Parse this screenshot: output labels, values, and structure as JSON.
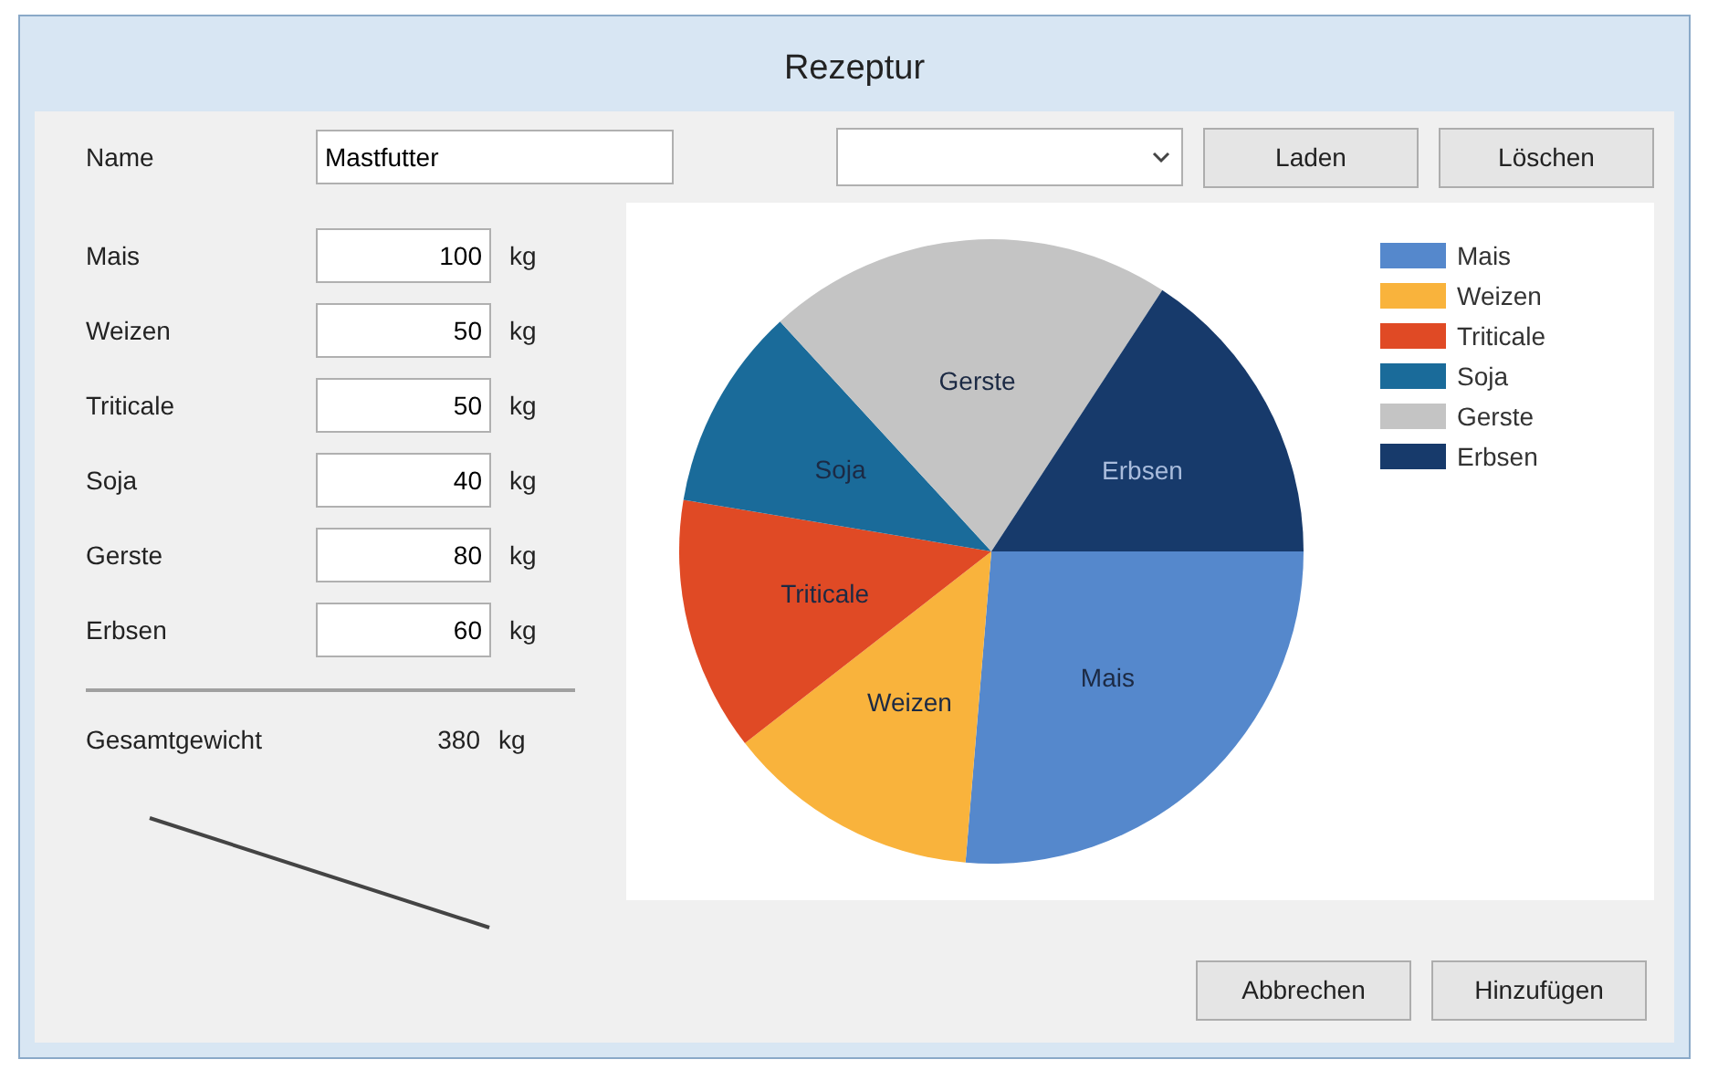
{
  "window": {
    "title": "Rezeptur"
  },
  "name_field": {
    "label": "Name",
    "value": "Mastfutter"
  },
  "buttons_top": [
    "Laden",
    "Löschen"
  ],
  "ingredients": [
    {
      "label": "Mais",
      "value": "100",
      "unit": "kg"
    },
    {
      "label": "Weizen",
      "value": "50",
      "unit": "kg"
    },
    {
      "label": "Triticale",
      "value": "50",
      "unit": "kg"
    },
    {
      "label": "Soja",
      "value": "40",
      "unit": "kg"
    },
    {
      "label": "Gerste",
      "value": "80",
      "unit": "kg"
    },
    {
      "label": "Erbsen",
      "value": "60",
      "unit": "kg"
    }
  ],
  "total": {
    "label": "Gesamtgewicht",
    "value": "380",
    "unit": "kg"
  },
  "chart": {
    "chart_data": {
      "type": "pie",
      "categories": [
        "Mais",
        "Weizen",
        "Triticale",
        "Soja",
        "Gerste",
        "Erbsen"
      ],
      "values": [
        26.32,
        13.16,
        13.16,
        10.53,
        21.05,
        15.78
      ]
    },
    "legend": [
      {
        "label": "Mais",
        "color": "#5588cc"
      },
      {
        "label": "Weizen",
        "color": "#f9b33c"
      },
      {
        "label": "Triticale",
        "color": "#e04a25"
      },
      {
        "label": "Soja",
        "color": "#1a6b9a"
      },
      {
        "label": "Gerste",
        "color": "#c4c4c4"
      },
      {
        "label": "Erbsen",
        "color": "#173a6b"
      }
    ]
  },
  "buttons_bottom": [
    "Abbrechen",
    "Hinzufügen"
  ]
}
